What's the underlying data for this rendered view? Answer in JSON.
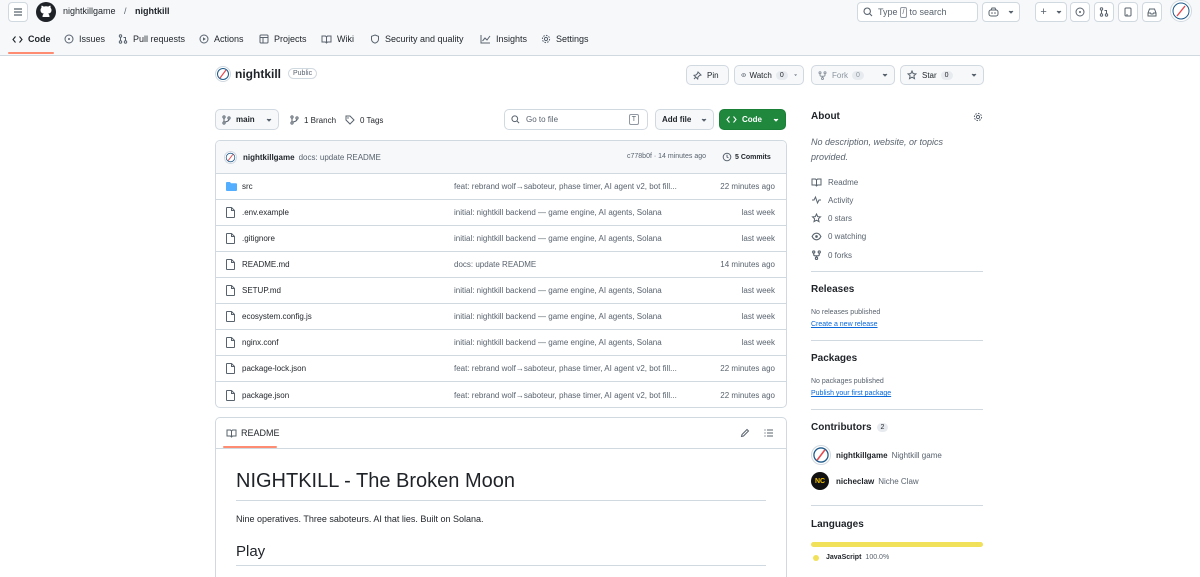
{
  "header": {
    "owner": "nightkillgame",
    "separator": "/",
    "repo": "nightkill",
    "search_prefix": "Type",
    "search_key": "/",
    "search_suffix": "to search",
    "plus_label": "+"
  },
  "nav": {
    "tabs": [
      {
        "label": "Code"
      },
      {
        "label": "Issues"
      },
      {
        "label": "Pull requests"
      },
      {
        "label": "Actions"
      },
      {
        "label": "Projects"
      },
      {
        "label": "Wiki"
      },
      {
        "label": "Security and quality"
      },
      {
        "label": "Insights"
      },
      {
        "label": "Settings"
      }
    ]
  },
  "repo": {
    "name": "nightkill",
    "visibility": "Public",
    "pin": "Pin",
    "watch": "Watch",
    "watch_count": "0",
    "fork": "Fork",
    "fork_count": "0",
    "star": "Star",
    "star_count": "0"
  },
  "toolbar": {
    "branch": "main",
    "branches": "1 Branch",
    "tags": "0 Tags",
    "go_to_file": "Go to file",
    "go_to_file_key": "T",
    "add_file": "Add file",
    "code": "Code"
  },
  "commit": {
    "author": "nightkillgame",
    "message": "docs: update README",
    "hash_time": "c778b0f · 14 minutes ago",
    "commits": "5 Commits"
  },
  "files": [
    {
      "name": "src",
      "type": "dir",
      "message": "feat: rebrand wolf→saboteur, phase timer, AI agent v2, bot fill...",
      "date": "22 minutes ago"
    },
    {
      "name": ".env.example",
      "type": "file",
      "message": "initial: nightkill backend — game engine, AI agents, Solana",
      "date": "last week"
    },
    {
      "name": ".gitignore",
      "type": "file",
      "message": "initial: nightkill backend — game engine, AI agents, Solana",
      "date": "last week"
    },
    {
      "name": "README.md",
      "type": "file",
      "message": "docs: update README",
      "date": "14 minutes ago"
    },
    {
      "name": "SETUP.md",
      "type": "file",
      "message": "initial: nightkill backend — game engine, AI agents, Solana",
      "date": "last week"
    },
    {
      "name": "ecosystem.config.js",
      "type": "file",
      "message": "initial: nightkill backend — game engine, AI agents, Solana",
      "date": "last week"
    },
    {
      "name": "nginx.conf",
      "type": "file",
      "message": "initial: nightkill backend — game engine, AI agents, Solana",
      "date": "last week"
    },
    {
      "name": "package-lock.json",
      "type": "file",
      "message": "feat: rebrand wolf→saboteur, phase timer, AI agent v2, bot fill...",
      "date": "22 minutes ago"
    },
    {
      "name": "package.json",
      "type": "file",
      "message": "feat: rebrand wolf→saboteur, phase timer, AI agent v2, bot fill...",
      "date": "22 minutes ago"
    }
  ],
  "readme": {
    "tab": "README",
    "title": "NIGHTKILL - The Broken Moon",
    "tagline": "Nine operatives. Three saboteurs. AI that lies. Built on Solana.",
    "section": "Play"
  },
  "about": {
    "heading": "About",
    "description": "No description, website, or topics provided.",
    "items": [
      {
        "label": "Readme"
      },
      {
        "label": "Activity"
      },
      {
        "label": "0 stars"
      },
      {
        "label": "0 watching"
      },
      {
        "label": "0 forks"
      }
    ]
  },
  "releases": {
    "heading": "Releases",
    "empty": "No releases published",
    "link": "Create a new release"
  },
  "packages": {
    "heading": "Packages",
    "empty": "No packages published",
    "link": "Publish your first package"
  },
  "contributors": {
    "heading": "Contributors",
    "count": "2",
    "people": [
      {
        "handle": "nightkillgame",
        "name": "Nightkill game"
      },
      {
        "handle": "nicheclaw",
        "name": "Niche Claw",
        "initials": "NC"
      }
    ]
  },
  "languages": {
    "heading": "Languages",
    "items": [
      {
        "name": "JavaScript",
        "percent": "100.0%",
        "share": 100,
        "color": "#f1e05a"
      }
    ]
  },
  "colors": {
    "accent": "#1f883d",
    "link": "#0969da",
    "folder": "#54aeff",
    "tab_underline": "#fd8c73"
  }
}
